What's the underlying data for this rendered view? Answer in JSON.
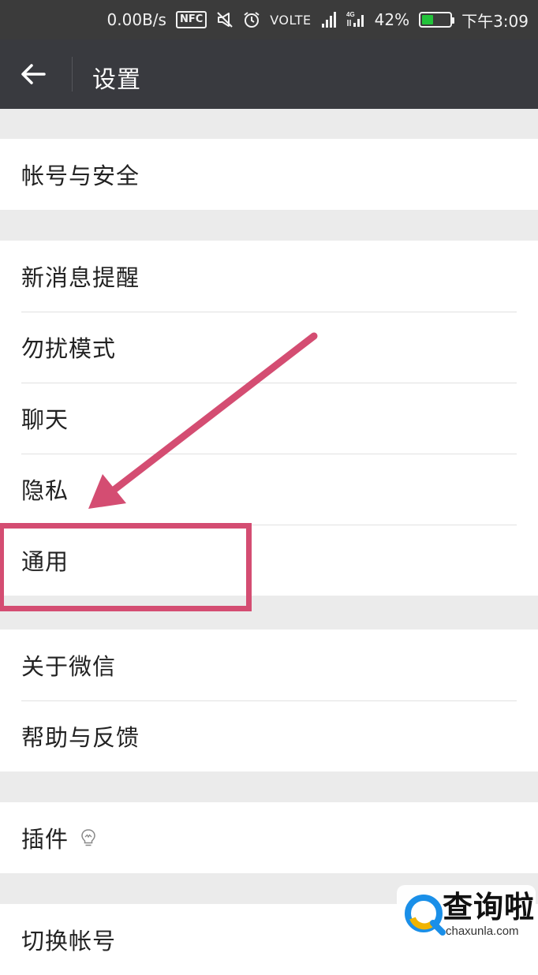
{
  "status_bar": {
    "net_speed": "0.00B/s",
    "nfc": "NFC",
    "volte": "VOLTE",
    "net_type": "4G",
    "battery_percent": "42%",
    "battery_level": 0.42,
    "time": "下午3:09",
    "icons": [
      "nfc-icon",
      "mute-icon",
      "alarm-icon",
      "signal-icon",
      "mobile-data-icon",
      "battery-icon"
    ]
  },
  "appbar": {
    "title": "设置",
    "back_icon": "arrow-left-icon"
  },
  "groups": [
    {
      "items": [
        {
          "label": "帐号与安全"
        }
      ]
    },
    {
      "items": [
        {
          "label": "新消息提醒"
        },
        {
          "label": "勿扰模式"
        },
        {
          "label": "聊天"
        },
        {
          "label": "隐私"
        },
        {
          "label": "通用"
        }
      ]
    },
    {
      "items": [
        {
          "label": "关于微信"
        },
        {
          "label": "帮助与反馈"
        }
      ]
    },
    {
      "items": [
        {
          "label": "插件",
          "icon": "lightbulb-icon"
        }
      ]
    },
    {
      "items": [
        {
          "label": "切换帐号"
        }
      ]
    }
  ],
  "annotation": {
    "highlighted_item": "通用",
    "color": "#d44d72"
  },
  "watermark": {
    "text_cn": "查询啦",
    "text_en": "chaxunla.com"
  },
  "colors": {
    "appbar": "#393a3f",
    "statusbar": "#3b3b3b",
    "background": "#ebebeb",
    "battery": "#22c33a"
  }
}
